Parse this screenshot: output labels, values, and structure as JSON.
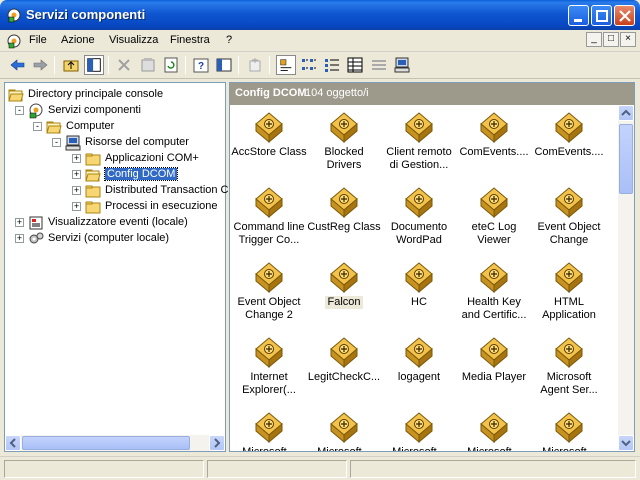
{
  "window": {
    "title": "Servizi componenti",
    "accent_color": "#0b55d6"
  },
  "menu": {
    "items": [
      "File",
      "Azione",
      "Visualizza",
      "Finestra",
      "?"
    ],
    "mdi_buttons": [
      "_",
      "□",
      "×"
    ]
  },
  "toolbar": {
    "buttons": [
      "back-arrow-icon",
      "forward-arrow-icon",
      "up-folder-icon",
      "show-hide-tree-icon",
      "delete-icon",
      "properties-icon",
      "refresh-icon",
      "help-icon",
      "export-list-icon",
      "new-window-icon",
      "large-icons-view-icon",
      "small-icons-view-icon",
      "list-view-icon",
      "details-view-icon",
      "dcom-config-icon",
      "computer-icon"
    ]
  },
  "tree": {
    "items": [
      {
        "label": "Directory principale console",
        "icon": "folder-open-icon",
        "level": 0,
        "expander": ""
      },
      {
        "label": "Servizi componenti",
        "icon": "component-services-icon",
        "level": 1,
        "expander": "-"
      },
      {
        "label": "Computer",
        "icon": "folder-open-icon",
        "level": 2,
        "expander": "-"
      },
      {
        "label": "Risorse del computer",
        "icon": "computer-icon",
        "level": 3,
        "expander": "-"
      },
      {
        "label": "Applicazioni COM+",
        "icon": "folder-icon",
        "level": 4,
        "expander": "+"
      },
      {
        "label": "Config DCOM",
        "icon": "folder-open-icon",
        "level": 4,
        "expander": "+",
        "selected": true
      },
      {
        "label": "Distributed Transaction C",
        "icon": "folder-icon",
        "level": 4,
        "expander": "+"
      },
      {
        "label": "Processi in esecuzione",
        "icon": "folder-icon",
        "level": 4,
        "expander": "+"
      },
      {
        "label": "Visualizzatore eventi (locale)",
        "icon": "event-viewer-icon",
        "level": 1,
        "expander": "+"
      },
      {
        "label": "Servizi (computer locale)",
        "icon": "services-gear-icon",
        "level": 1,
        "expander": "+"
      }
    ]
  },
  "details": {
    "title": "Config DCOM",
    "count": "104 oggetto/i",
    "header_color": "#9d9a8c",
    "items": [
      [
        "AccStore Class"
      ],
      [
        "Blocked",
        "Drivers"
      ],
      [
        "Client remoto",
        "di Gestion..."
      ],
      [
        "ComEvents...."
      ],
      [
        "ComEvents...."
      ],
      [
        "Command line",
        "Trigger Co..."
      ],
      [
        "CustReg Class"
      ],
      [
        "Documento",
        "WordPad"
      ],
      [
        "eteC Log",
        "Viewer"
      ],
      [
        "Event Object",
        "Change"
      ],
      [
        "Event Object",
        "Change 2"
      ],
      [
        "Falcon"
      ],
      [
        "HC"
      ],
      [
        "Health Key",
        "and Certific..."
      ],
      [
        "HTML",
        "Application"
      ],
      [
        "Internet",
        "Explorer(..."
      ],
      [
        "LegitCheckC..."
      ],
      [
        "logagent"
      ],
      [
        "Media Player"
      ],
      [
        "Microsoft",
        "Agent Ser..."
      ],
      [
        "Microsoft..."
      ],
      [
        "Microsoft..."
      ],
      [
        "Microsoft..."
      ],
      [
        "Microsoft..."
      ],
      [
        "Microsoft..."
      ]
    ],
    "highlighted_item": "Falcon"
  }
}
